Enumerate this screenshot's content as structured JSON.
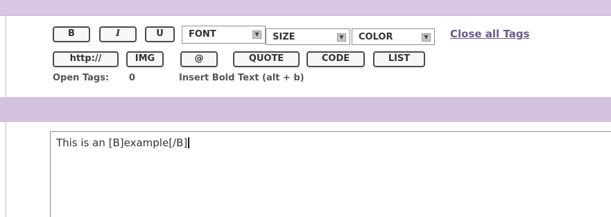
{
  "toolbar": {
    "buttons_row1": [
      {
        "label": "B"
      },
      {
        "label": "I"
      },
      {
        "label": "U"
      }
    ],
    "selects": [
      {
        "selected": "FONT"
      },
      {
        "selected": "SIZE"
      },
      {
        "selected": "COLOR"
      }
    ],
    "close_all_tags": "Close all Tags",
    "buttons_row2": [
      {
        "label": "http://"
      },
      {
        "label": "IMG"
      },
      {
        "label": "@"
      },
      {
        "label": "QUOTE"
      },
      {
        "label": "CODE"
      },
      {
        "label": "LIST"
      }
    ]
  },
  "status": {
    "open_tags_label": "Open Tags:",
    "open_tags_count": "0",
    "hint": "Insert Bold Text (alt + b)"
  },
  "editor": {
    "value": "This is an [B]example[/B]"
  },
  "colors": {
    "band": "#d9c6e4",
    "link": "#6b5a8a",
    "button_border": "#4a4a4a"
  },
  "icons": {
    "select_arrow": "chevron-down-icon"
  }
}
